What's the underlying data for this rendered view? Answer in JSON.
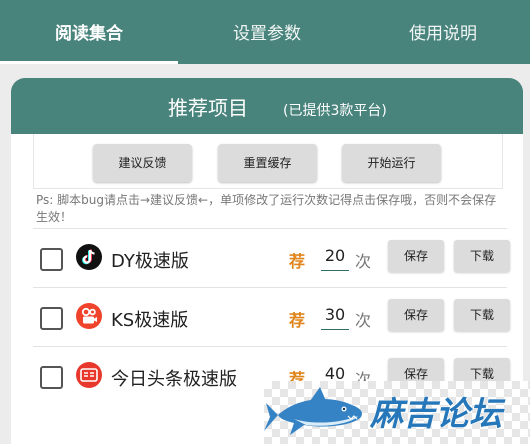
{
  "tabs": [
    {
      "label": "阅读集合",
      "active": true
    },
    {
      "label": "设置参数",
      "active": false
    },
    {
      "label": "使用说明",
      "active": false
    }
  ],
  "card": {
    "title": "推荐项目",
    "subtitle": "(已提供3款平台)",
    "buttons": {
      "feedback": "建议反馈",
      "reset_cache": "重置缓存",
      "start": "开始运行"
    },
    "note": "Ps: 脚本bug请点击→建议反馈←，单项修改了运行次数记得点击保存哦，否则不会保存生效！"
  },
  "apps": [
    {
      "name": "DY极速版",
      "icon": "douyin-icon",
      "recommend": "荐",
      "count": "20",
      "unit": "次",
      "save": "保存",
      "download": "下载",
      "checked": false
    },
    {
      "name": "KS极速版",
      "icon": "kuaishou-icon",
      "recommend": "荐",
      "count": "30",
      "unit": "次",
      "save": "保存",
      "download": "下载",
      "checked": false
    },
    {
      "name": "今日头条极速版",
      "icon": "toutiao-icon",
      "recommend": "荐",
      "count": "40",
      "unit": "次",
      "save": "保存",
      "download": "下载",
      "checked": false
    }
  ],
  "watermark": {
    "text": "麻吉论坛"
  },
  "colors": {
    "primary": "#48837c",
    "accent": "#e0851c",
    "douyin": "#111111",
    "kuaishou": "#f0432c",
    "toutiao": "#e8382b"
  }
}
